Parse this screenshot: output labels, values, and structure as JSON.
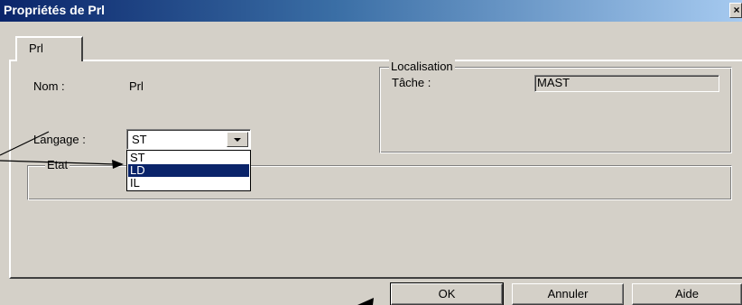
{
  "window": {
    "title": "Propriétés de Prl",
    "close_glyph": "×"
  },
  "tabs": [
    {
      "label": "Prl"
    }
  ],
  "fields": {
    "nom_label": "Nom :",
    "nom_value": "Prl",
    "langage_label": "Langage :",
    "langage_value": "ST",
    "langage_options": [
      "ST",
      "LD",
      "IL"
    ],
    "langage_highlighted": "LD"
  },
  "groups": {
    "localisation": {
      "legend": "Localisation",
      "tache_label": "Tâche :",
      "tache_value": "MAST"
    },
    "etat": {
      "legend": "Etat"
    }
  },
  "buttons": {
    "ok": "OK",
    "annuler": "Annuler",
    "aide": "Aide"
  },
  "icons": {
    "dropdown": "chevron-down-icon",
    "close": "close-icon"
  },
  "colors": {
    "titlebar_start": "#0a246a",
    "titlebar_end": "#a6caf0",
    "face": "#d4d0c8",
    "selection": "#0a246a"
  }
}
